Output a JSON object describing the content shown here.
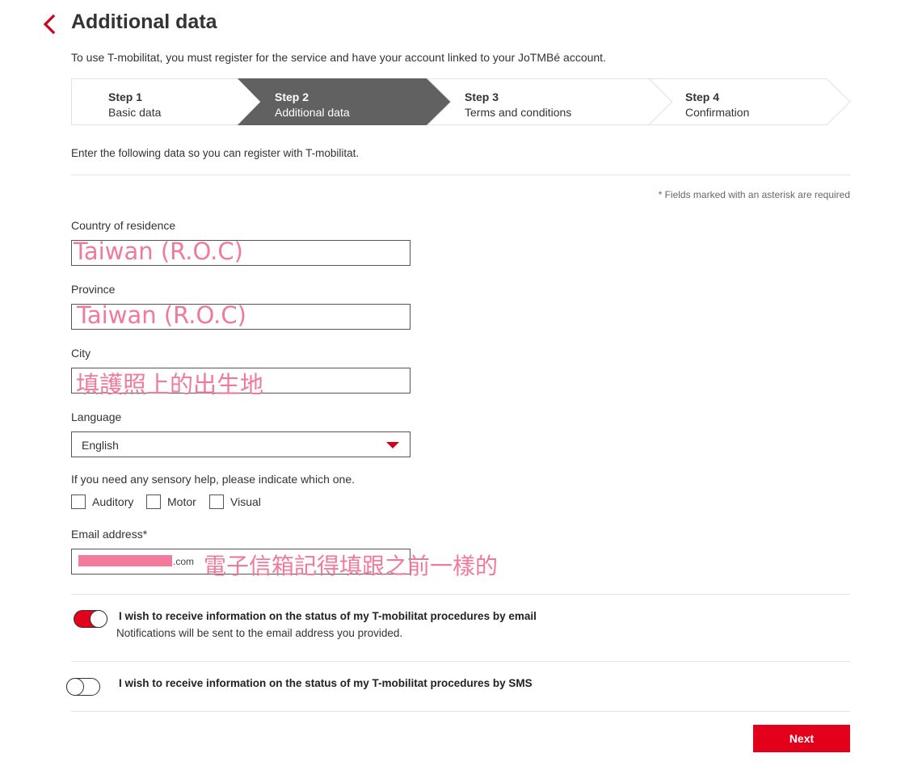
{
  "header": {
    "title": "Additional data",
    "intro": "To use T-mobilitat, you must register for the service and have your account linked to your JoTMBé account."
  },
  "steps": [
    {
      "num": "Step 1",
      "label": "Basic data",
      "active": false
    },
    {
      "num": "Step 2",
      "label": "Additional data",
      "active": true
    },
    {
      "num": "Step 3",
      "label": "Terms and conditions",
      "active": false
    },
    {
      "num": "Step 4",
      "label": "Confirmation",
      "active": false
    }
  ],
  "form": {
    "subtitle": "Enter the following data so you can register with T-mobilitat.",
    "required_note": "* Fields marked with an asterisk are required",
    "country": {
      "label": "Country of residence",
      "annotation": "Taiwan (R.O.C)"
    },
    "province": {
      "label": "Province",
      "annotation": "Taiwan (R.O.C)"
    },
    "city": {
      "label": "City",
      "annotation": "填護照上的出生地"
    },
    "language": {
      "label": "Language",
      "value": "English"
    },
    "sensory": {
      "question": "If you need any sensory help, please indicate which one.",
      "options": [
        "Auditory",
        "Motor",
        "Visual"
      ]
    },
    "email": {
      "label": "Email address*",
      "suffix": ".com",
      "annotation": "電子信箱記得填跟之前一樣的"
    }
  },
  "notifications": {
    "email": {
      "title": "I wish to receive information on the status of my T-mobilitat procedures by email",
      "desc": "Notifications will be sent to the email address you provided.",
      "on": true
    },
    "sms": {
      "title": "I wish to receive information on the status of my T-mobilitat procedures by SMS",
      "on": false
    }
  },
  "actions": {
    "next_label": "Next"
  },
  "colors": {
    "accent": "#e3001b",
    "active_step": "#616161",
    "annotation": "#f07a9a"
  }
}
